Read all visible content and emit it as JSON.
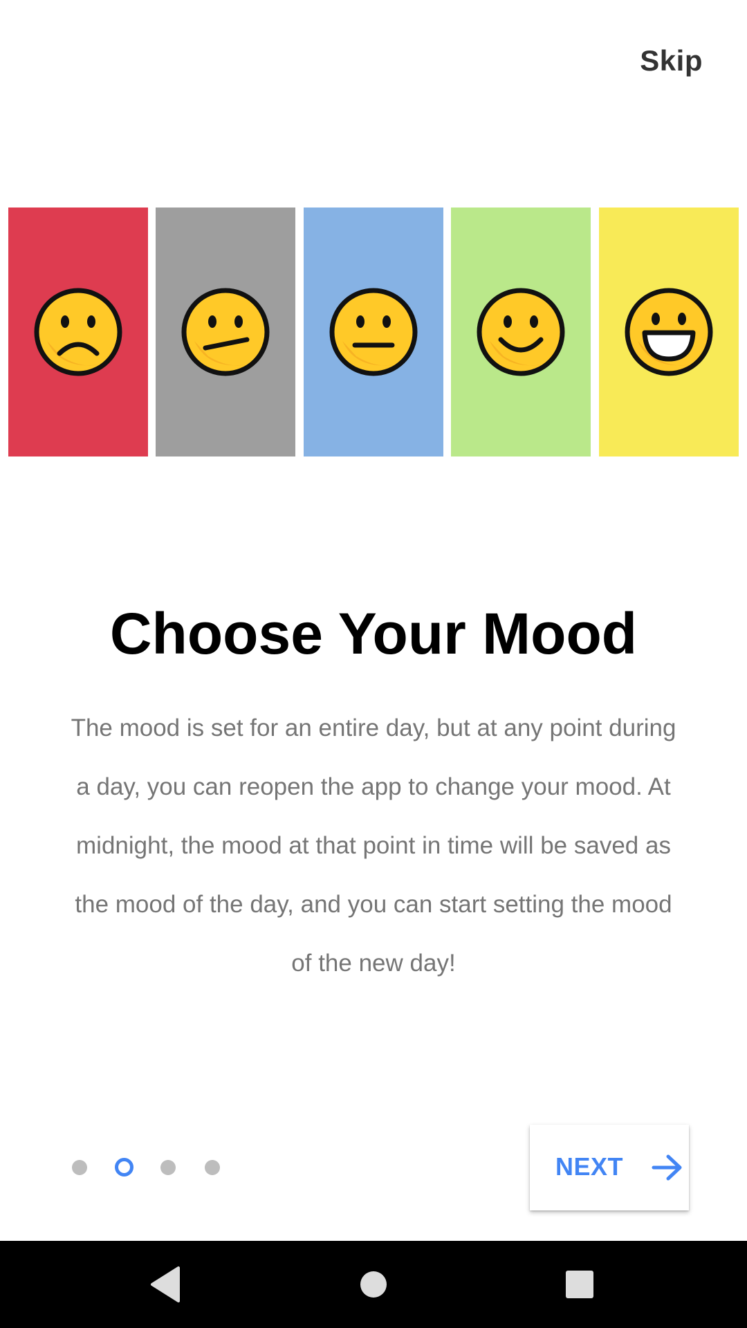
{
  "header": {
    "skip_label": "Skip"
  },
  "moods": [
    {
      "name": "very-sad",
      "color": "#DE3C50",
      "icon": "frowning-face-icon"
    },
    {
      "name": "confused",
      "color": "#9E9E9E",
      "icon": "confused-face-icon"
    },
    {
      "name": "neutral",
      "color": "#86B2E4",
      "icon": "neutral-face-icon"
    },
    {
      "name": "happy",
      "color": "#BAE88A",
      "icon": "smiling-face-icon"
    },
    {
      "name": "very-happy",
      "color": "#F8EA57",
      "icon": "grinning-face-icon"
    }
  ],
  "content": {
    "title": "Choose Your Mood",
    "description": "The mood is set for an entire day, but at any point during a day, you can reopen the app to change your mood. At midnight, the mood at that point in time will be saved as the mood of the day, and you can start setting the mood of the new day!"
  },
  "pager": {
    "total_pages": 4,
    "current_page": 2,
    "active_color": "#4285F4",
    "inactive_color": "#BDBDBD"
  },
  "footer": {
    "next_label": "NEXT",
    "next_icon": "arrow-right-icon"
  },
  "system_nav": {
    "back_icon": "back-triangle-icon",
    "home_icon": "home-circle-icon",
    "recents_icon": "recents-square-icon"
  }
}
